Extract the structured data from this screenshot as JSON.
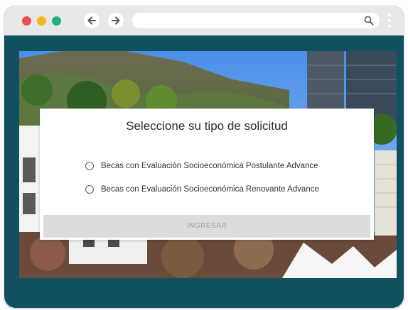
{
  "browser": {
    "icons": {
      "back": "arrow-left-icon",
      "forward": "arrow-right-icon",
      "search": "search-icon",
      "menu": "kebab-menu-icon"
    },
    "window_controls": [
      "close",
      "minimize",
      "maximize"
    ],
    "colors": {
      "chrome_bg": "#e8e8e8",
      "page_frame": "#11505f",
      "close": "#ef4b55",
      "minimize": "#f7b51c",
      "maximize": "#22b07d"
    }
  },
  "form": {
    "title": "Seleccione su tipo de solicitud",
    "options": [
      {
        "label": "Becas con Evaluación Socioeconómica Postulante Advance",
        "selected": false
      },
      {
        "label": "Becas con Evaluación Socioeconómica Renovante Advance",
        "selected": false
      }
    ],
    "submit_label": "INGRESAR",
    "submit_enabled": false
  }
}
